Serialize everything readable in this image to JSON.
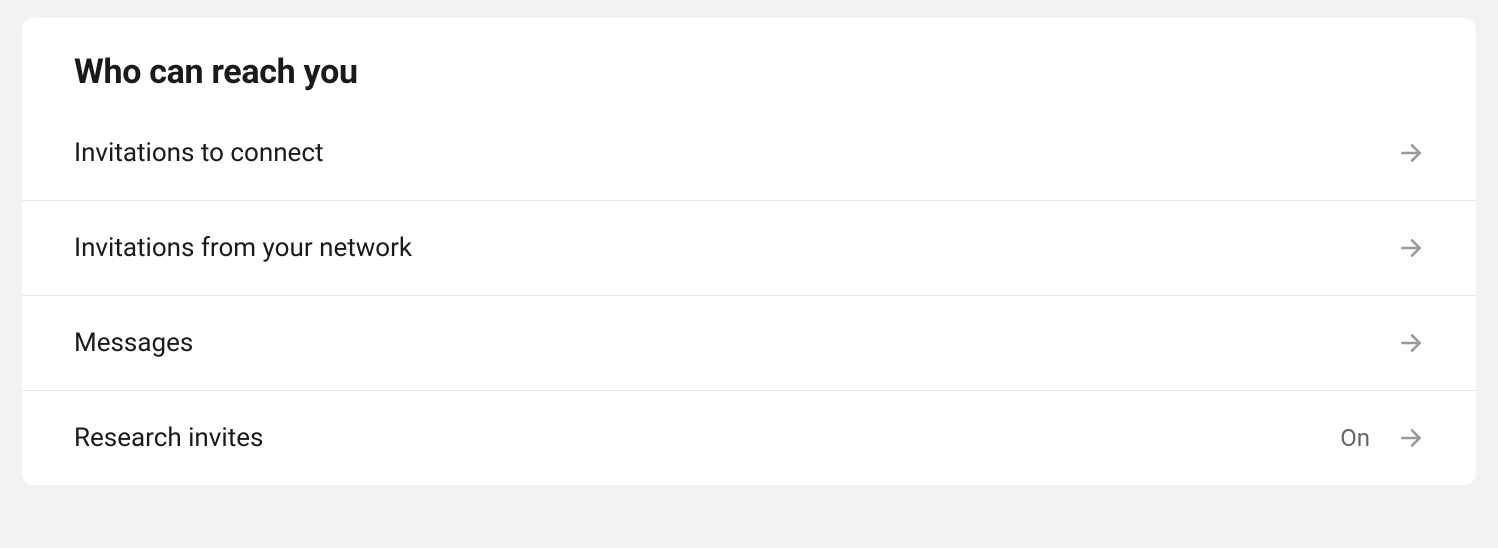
{
  "section": {
    "title": "Who can reach you",
    "items": [
      {
        "label": "Invitations to connect",
        "value": ""
      },
      {
        "label": "Invitations from your network",
        "value": ""
      },
      {
        "label": "Messages",
        "value": ""
      },
      {
        "label": "Research invites",
        "value": "On"
      }
    ]
  }
}
